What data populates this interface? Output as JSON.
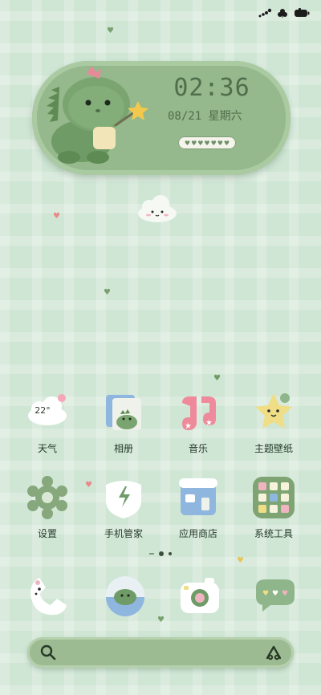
{
  "clock": {
    "time": "02:36",
    "date": "08/21 星期六"
  },
  "apps_row1": [
    {
      "label": "天气",
      "icon": "weather-cloud-icon",
      "temp": "22°"
    },
    {
      "label": "相册",
      "icon": "album-icon"
    },
    {
      "label": "音乐",
      "icon": "music-icon"
    },
    {
      "label": "主题壁纸",
      "icon": "theme-star-icon"
    }
  ],
  "apps_row2": [
    {
      "label": "设置",
      "icon": "settings-gear-icon"
    },
    {
      "label": "手机管家",
      "icon": "phone-manager-icon"
    },
    {
      "label": "应用商店",
      "icon": "app-store-icon"
    },
    {
      "label": "系统工具",
      "icon": "system-tools-icon"
    }
  ],
  "dock": [
    {
      "icon": "phone-icon"
    },
    {
      "icon": "browser-icon"
    },
    {
      "icon": "camera-icon"
    },
    {
      "icon": "messages-icon"
    }
  ],
  "colors": {
    "accent_green": "#95b88c",
    "dark_green": "#4f6e4b",
    "background": "#cfe6d5"
  }
}
